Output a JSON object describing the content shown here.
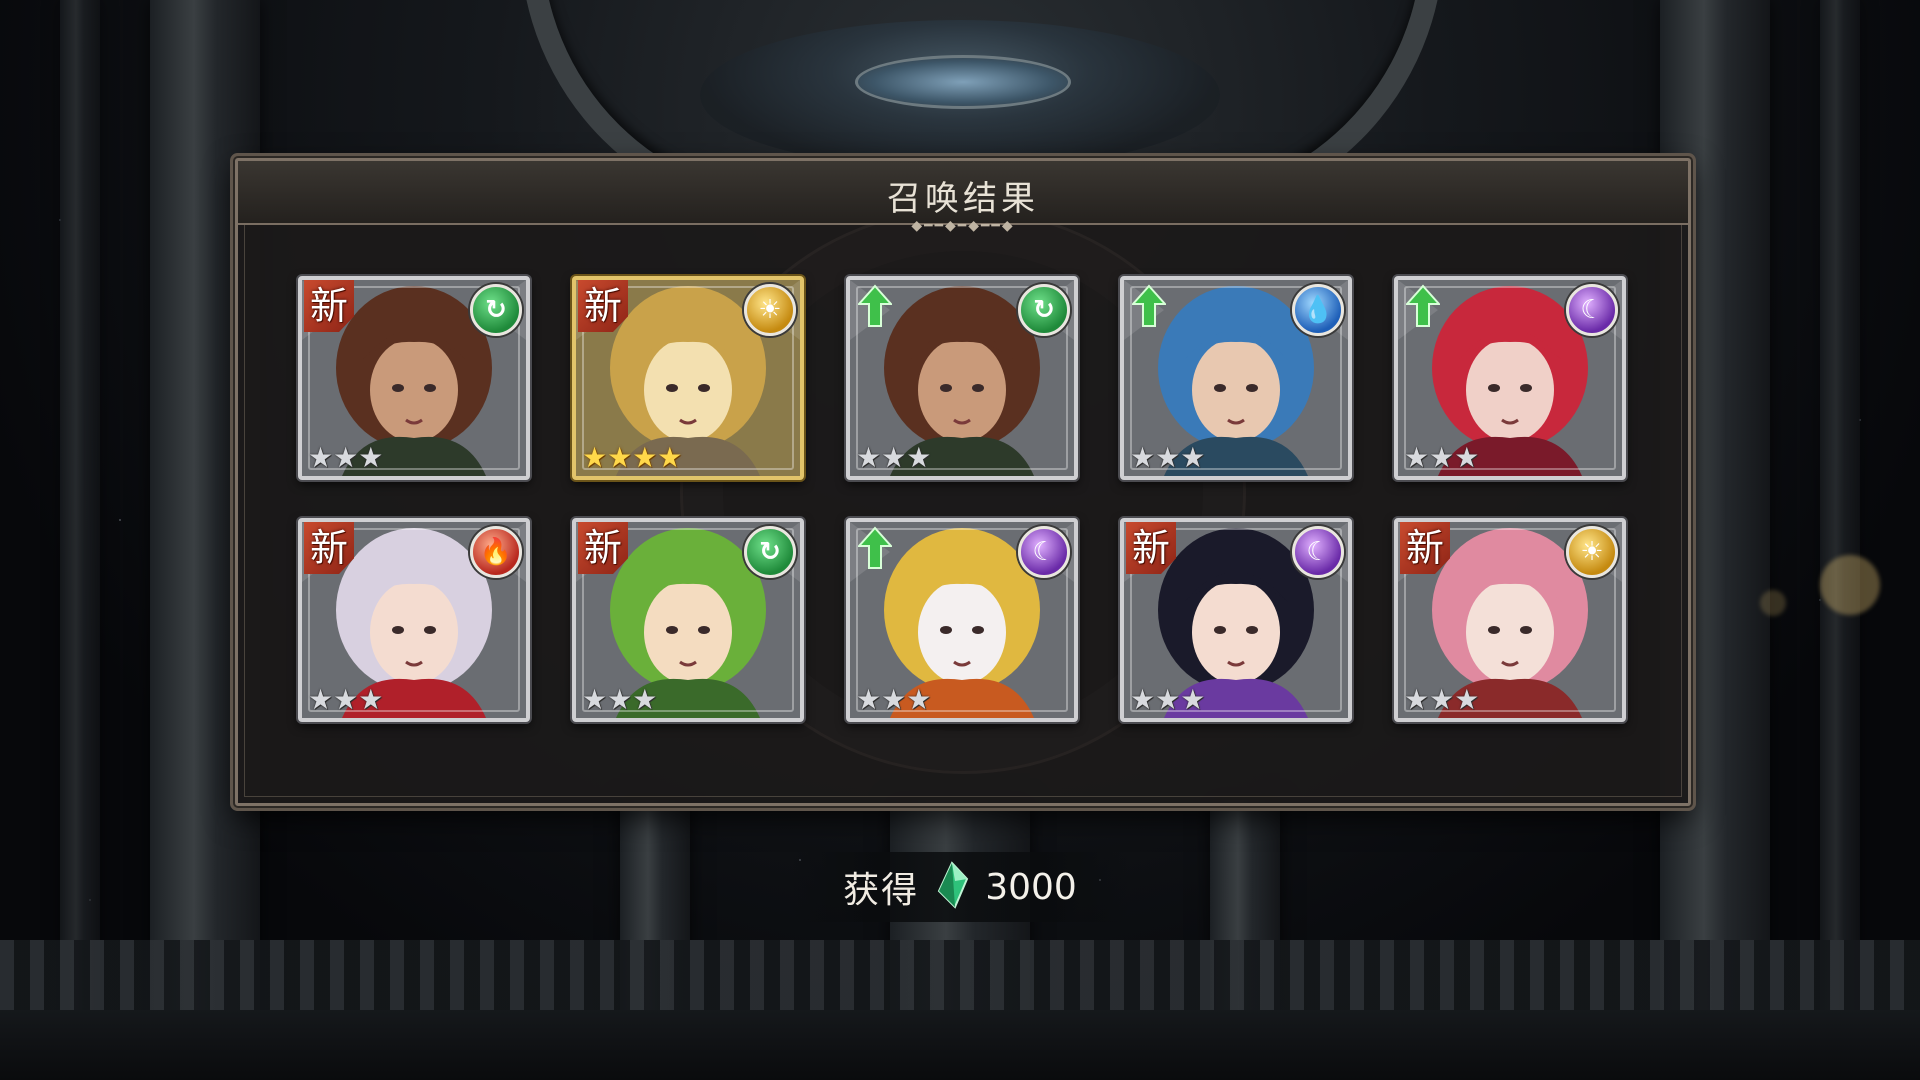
{
  "title": "召唤结果",
  "reward": {
    "label": "获得",
    "icon": "green-crystal-icon",
    "amount": "3000"
  },
  "results": [
    {
      "badge": "新",
      "badge_type": "new",
      "element": "wind",
      "element_icon": "wind-element-icon",
      "rarity": 3,
      "stars": "★★★",
      "portrait": "brown-haired-bearded-man",
      "colors": [
        "#5a3020",
        "#c99a7a",
        "#2d3a2a"
      ]
    },
    {
      "badge": "新",
      "badge_type": "new",
      "element": "light",
      "element_icon": "light-element-icon",
      "rarity": 4,
      "stars": "★★★★",
      "portrait": "blonde-long-haired-man",
      "colors": [
        "#c9a24a",
        "#f3e0b0",
        "#7a6a50"
      ]
    },
    {
      "badge": "",
      "badge_type": "upgrade",
      "element": "wind",
      "element_icon": "wind-element-icon",
      "rarity": 3,
      "stars": "★★★",
      "portrait": "brown-haired-bearded-man",
      "colors": [
        "#5a3020",
        "#c99a7a",
        "#2d3a2a"
      ]
    },
    {
      "badge": "",
      "badge_type": "upgrade",
      "element": "water",
      "element_icon": "water-element-icon",
      "rarity": 3,
      "stars": "★★★",
      "portrait": "blue-haired-elf",
      "colors": [
        "#3a7ab8",
        "#e8c8b0",
        "#2a4a60"
      ]
    },
    {
      "badge": "",
      "badge_type": "upgrade",
      "element": "dark",
      "element_icon": "dark-element-icon",
      "rarity": 3,
      "stars": "★★★",
      "portrait": "red-haired-woman",
      "colors": [
        "#c8283c",
        "#f0d0c8",
        "#7a1a2a"
      ]
    },
    {
      "badge": "新",
      "badge_type": "new",
      "element": "fire",
      "element_icon": "fire-element-icon",
      "rarity": 3,
      "stars": "★★★",
      "portrait": "silver-haired-girl-red-kimono",
      "colors": [
        "#d8d0e0",
        "#f4dcd0",
        "#b0202a"
      ]
    },
    {
      "badge": "新",
      "badge_type": "new",
      "element": "wind",
      "element_icon": "wind-element-icon",
      "rarity": 3,
      "stars": "★★★",
      "portrait": "green-haired-girl",
      "colors": [
        "#6ab03a",
        "#f4dcc0",
        "#3a6a2a"
      ]
    },
    {
      "badge": "",
      "badge_type": "upgrade",
      "element": "dark",
      "element_icon": "dark-element-icon",
      "rarity": 3,
      "stars": "★★★",
      "portrait": "blonde-masked-girl-hood",
      "colors": [
        "#e0b840",
        "#f4f0f0",
        "#c85a20"
      ]
    },
    {
      "badge": "新",
      "badge_type": "new",
      "element": "dark",
      "element_icon": "dark-element-icon",
      "rarity": 3,
      "stars": "★★★",
      "portrait": "black-haired-horned-girl",
      "colors": [
        "#1a1a2a",
        "#f4dcd0",
        "#6a3aa0"
      ]
    },
    {
      "badge": "新",
      "badge_type": "new",
      "element": "light",
      "element_icon": "light-element-icon",
      "rarity": 3,
      "stars": "★★★",
      "portrait": "pink-haired-girl-glasses",
      "colors": [
        "#e08aa0",
        "#f4e0d8",
        "#8a2a2a"
      ]
    }
  ]
}
